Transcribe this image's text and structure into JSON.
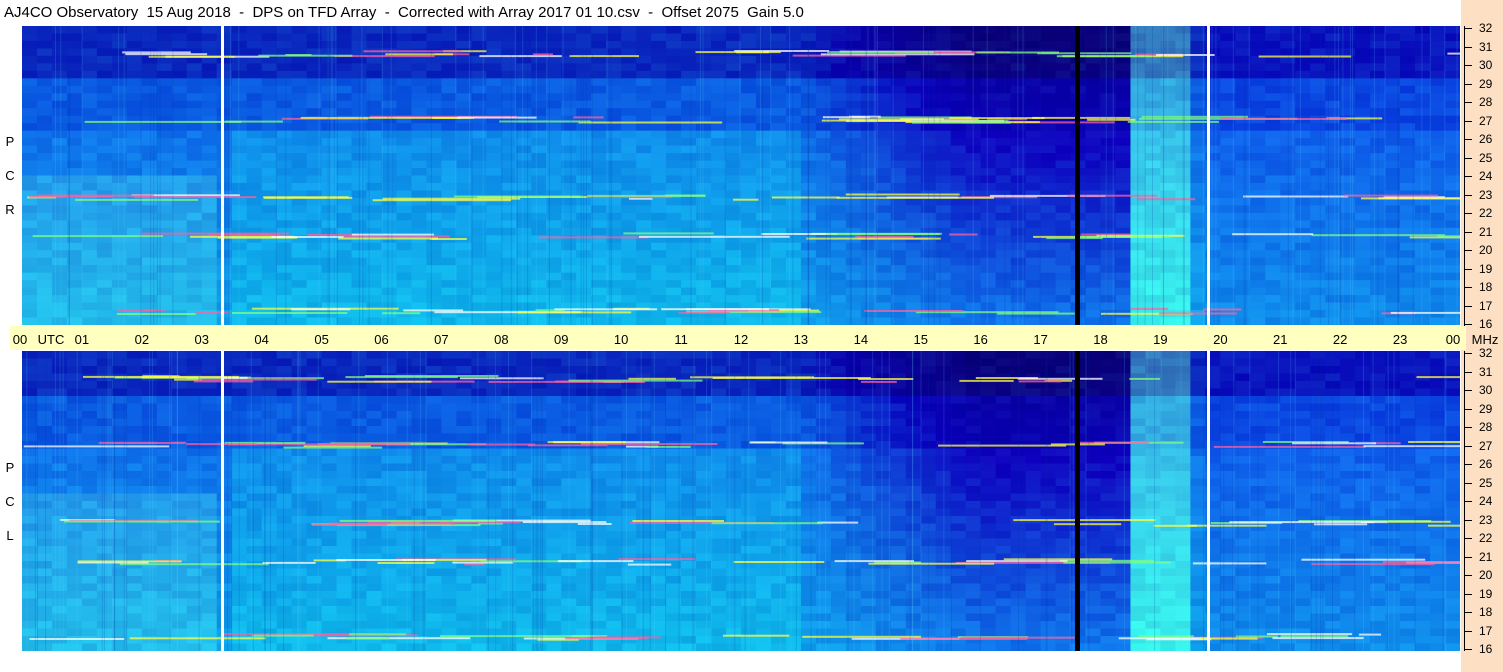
{
  "title": "AJ4CO Observatory  15 Aug 2018  -  DPS on TFD Array  -  Corrected with Array 2017 01 10.csv  -  Offset 2075  Gain 5.0",
  "chart_data": {
    "type": "heatmap",
    "title": "AJ4CO Observatory  15 Aug 2018  -  DPS on TFD Array  -  Corrected with Array 2017 01 10.csv  -  Offset 2075  Gain 5.0",
    "x_axis": {
      "unit_label": "UTC",
      "ticks": [
        "00",
        "01",
        "02",
        "03",
        "04",
        "05",
        "06",
        "07",
        "08",
        "09",
        "10",
        "11",
        "12",
        "13",
        "14",
        "15",
        "16",
        "17",
        "18",
        "19",
        "20",
        "21",
        "22",
        "23",
        "00"
      ],
      "range": [
        0,
        24
      ]
    },
    "y_axis": {
      "unit_label": "MHz",
      "ticks": [
        16,
        17,
        18,
        19,
        20,
        21,
        22,
        23,
        24,
        25,
        26,
        27,
        28,
        29,
        30,
        31,
        32
      ],
      "range": [
        16,
        32
      ]
    },
    "panels": [
      {
        "name": "R C P",
        "labels": [
          "R",
          "C",
          "P"
        ]
      },
      {
        "name": "L C P",
        "labels": [
          "L",
          "C",
          "P"
        ]
      }
    ],
    "markers": [
      {
        "utc": 3.35,
        "color": "#ffffff"
      },
      {
        "utc": 17.6,
        "color": "#000000"
      },
      {
        "utc": 19.8,
        "color": "#ffffff"
      }
    ]
  }
}
